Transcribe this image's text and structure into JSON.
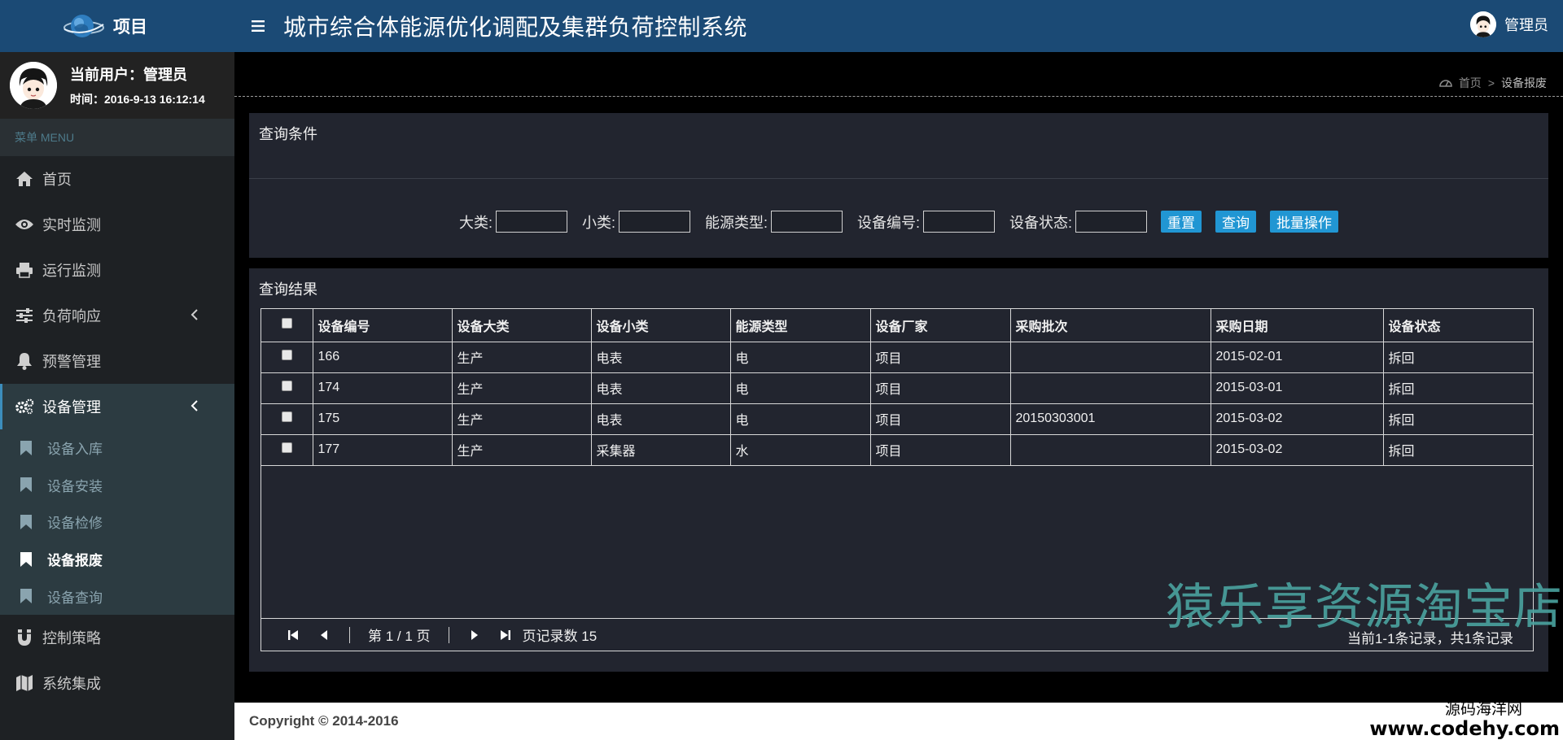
{
  "brand": {
    "title": "项目"
  },
  "user": {
    "current": "当前用户：管理员",
    "time": "时间：2016-9-13 16:12:14"
  },
  "menu": {
    "header": "菜单 MENU",
    "items": [
      {
        "label": "首页",
        "icon": "home-icon"
      },
      {
        "label": "实时监测",
        "icon": "eye-icon"
      },
      {
        "label": "运行监测",
        "icon": "printer-icon"
      },
      {
        "label": "负荷响应",
        "icon": "sliders-icon"
      },
      {
        "label": "预警管理",
        "icon": "bell-icon"
      },
      {
        "label": "设备管理",
        "icon": "gears-icon"
      },
      {
        "label": "控制策略",
        "icon": "magnet-icon"
      },
      {
        "label": "系统集成",
        "icon": "map-icon"
      }
    ],
    "submenu": [
      {
        "label": "设备入库"
      },
      {
        "label": "设备安装"
      },
      {
        "label": "设备检修"
      },
      {
        "label": "设备报废"
      },
      {
        "label": "设备查询"
      }
    ]
  },
  "topbar": {
    "title": "城市综合体能源优化调配及集群负荷控制系统",
    "user": "管理员"
  },
  "breadcrumb": {
    "home": "首页",
    "sep": ">",
    "current": "设备报废"
  },
  "query": {
    "title": "查询条件",
    "fields": [
      {
        "label": "大类:",
        "value": ""
      },
      {
        "label": "小类:",
        "value": ""
      },
      {
        "label": "能源类型:",
        "value": ""
      },
      {
        "label": "设备编号:",
        "value": ""
      },
      {
        "label": "设备状态:",
        "value": ""
      }
    ],
    "buttons": {
      "reset": "重置",
      "search": "查询",
      "batch": "批量操作"
    }
  },
  "result": {
    "title": "查询结果",
    "columns": [
      "设备编号",
      "设备大类",
      "设备小类",
      "能源类型",
      "设备厂家",
      "采购批次",
      "采购日期",
      "设备状态"
    ],
    "rows": [
      [
        "166",
        "生产",
        "电表",
        "电",
        "项目",
        "",
        "2015-02-01",
        "拆回"
      ],
      [
        "174",
        "生产",
        "电表",
        "电",
        "项目",
        "",
        "2015-03-01",
        "拆回"
      ],
      [
        "175",
        "生产",
        "电表",
        "电",
        "项目",
        "20150303001",
        "2015-03-02",
        "拆回"
      ],
      [
        "177",
        "生产",
        "采集器",
        "水",
        "项目",
        "",
        "2015-03-02",
        "拆回"
      ]
    ]
  },
  "pager": {
    "page": "第 1 / 1 页",
    "page_size": "页记录数 15",
    "summary": "当前1-1条记录，共1条记录"
  },
  "watermark": "猿乐享资源淘宝店",
  "footer": {
    "copyright": "Copyright © 2014-2016"
  },
  "corner": {
    "line1": "源码海洋网",
    "line2": "www.codehy.com"
  }
}
